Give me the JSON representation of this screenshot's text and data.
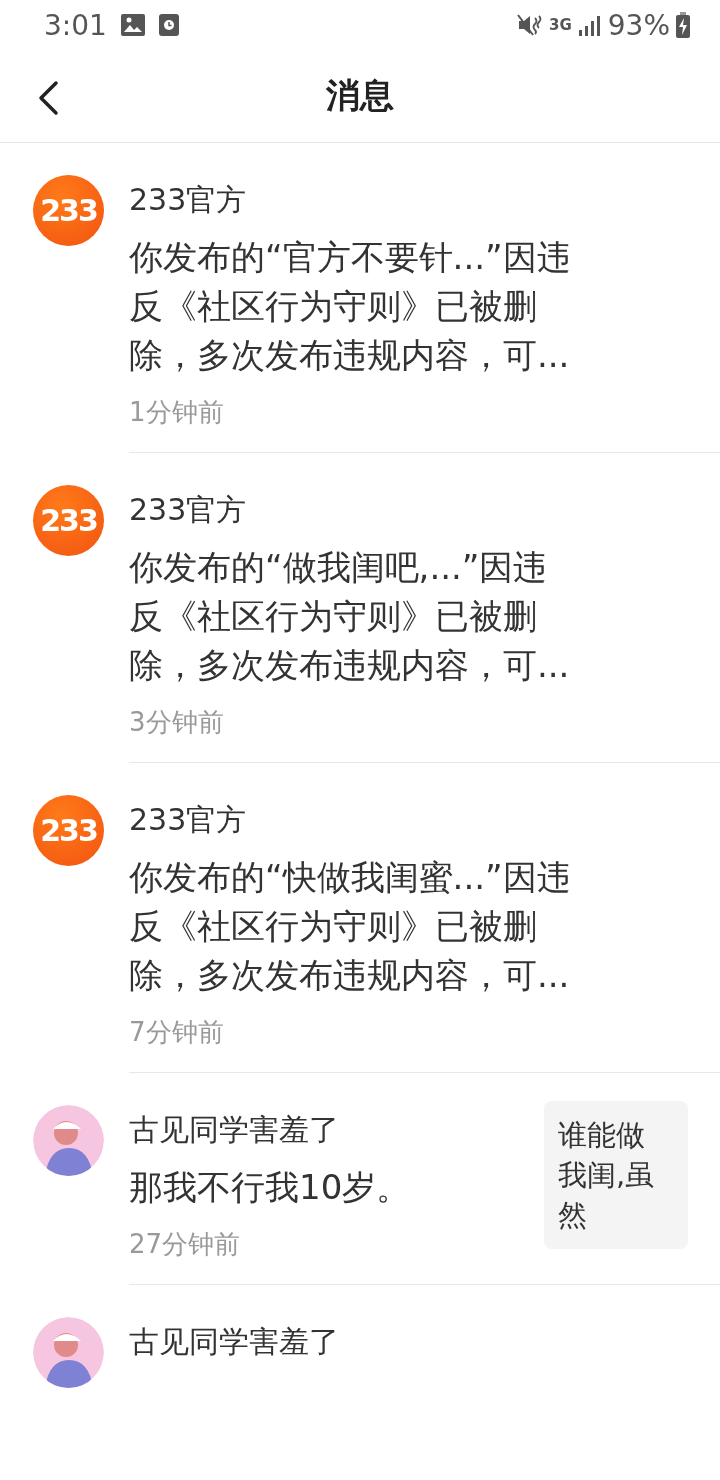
{
  "status_bar": {
    "time": "3:01",
    "network": "3G",
    "battery": "93%"
  },
  "header": {
    "title": "消息"
  },
  "messages": [
    {
      "kind": "official",
      "avatar_text": "233",
      "sender": "233官方",
      "lines": [
        "你发布的“官方不要针...”因违",
        "反《社区行为守则》已被删",
        "除，多次发布违规内容，可..."
      ],
      "time": "1分钟前"
    },
    {
      "kind": "official",
      "avatar_text": "233",
      "sender": "233官方",
      "lines": [
        "你发布的“做我闺吧,...”因违",
        "反《社区行为守则》已被删",
        "除，多次发布违规内容，可..."
      ],
      "time": "3分钟前"
    },
    {
      "kind": "official",
      "avatar_text": "233",
      "sender": "233官方",
      "lines": [
        "你发布的“快做我闺蜜...”因违",
        "反《社区行为守则》已被删",
        "除，多次发布违规内容，可..."
      ],
      "time": "7分钟前"
    },
    {
      "kind": "comment",
      "sender": "古见同学害羞了",
      "lines": [
        "那我不行我10岁。"
      ],
      "time": "27分钟前",
      "quote_lines": [
        "谁能做",
        "我闺,虽",
        "然"
      ]
    },
    {
      "kind": "comment",
      "sender": "古见同学害羞了"
    }
  ]
}
